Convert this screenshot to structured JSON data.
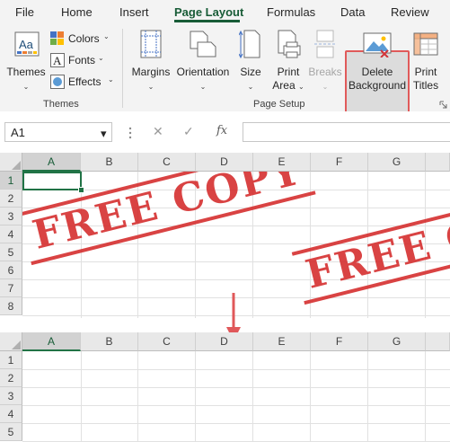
{
  "menu": {
    "tabs": [
      {
        "label": "File"
      },
      {
        "label": "Home"
      },
      {
        "label": "Insert"
      },
      {
        "label": "Page Layout"
      },
      {
        "label": "Formulas"
      },
      {
        "label": "Data"
      },
      {
        "label": "Review"
      }
    ],
    "active_tab": "Page Layout"
  },
  "ribbon": {
    "themes_group": {
      "themes_label": "Themes",
      "colors_label": "Colors",
      "fonts_label": "Fonts",
      "effects_label": "Effects",
      "group_label": "Themes"
    },
    "page_setup_group": {
      "margins_label": "Margins",
      "orientation_label": "Orientation",
      "size_label": "Size",
      "print_area_line1": "Print",
      "print_area_line2": "Area",
      "breaks_label": "Breaks",
      "delete_bg_line1": "Delete",
      "delete_bg_line2": "Background",
      "print_titles_line1": "Print",
      "print_titles_line2": "Titles",
      "group_label": "Page Setup"
    }
  },
  "formula_bar": {
    "name_box": "A1",
    "fx": "fx",
    "value": ""
  },
  "columns": [
    "A",
    "B",
    "C",
    "D",
    "E",
    "F",
    "G"
  ],
  "top_rows": [
    "1",
    "2",
    "3",
    "4",
    "5",
    "6",
    "7",
    "8"
  ],
  "bottom_rows": [
    "1",
    "2",
    "3",
    "4",
    "5"
  ],
  "background": {
    "stamp_text": "FREE COPY",
    "stamp_text_partial": "FREE C",
    "stamp_color": "#d42a2a"
  },
  "colors": {
    "accent": "#217346",
    "highlight_border": "#e05a5a",
    "arrow": "#e0585a"
  }
}
